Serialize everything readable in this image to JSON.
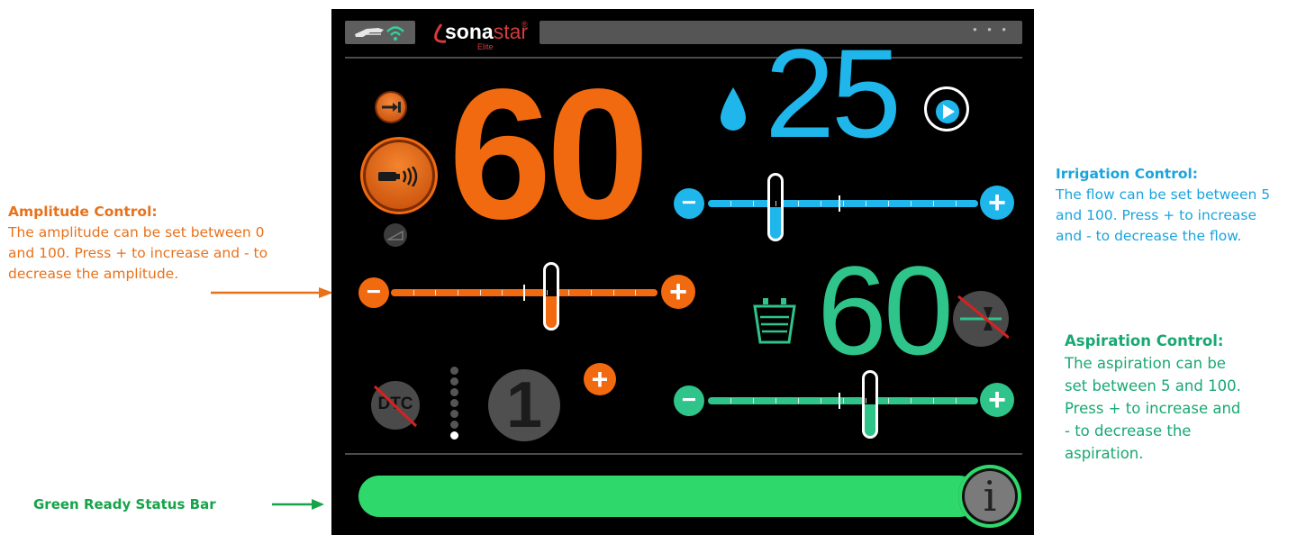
{
  "annotations": {
    "amplitude": {
      "title": "Amplitude Control:",
      "l1": "The amplitude can be set between 0",
      "l2": "and 100. Press + to increase and - to",
      "l3": "decrease the amplitude."
    },
    "irrigation": {
      "title": "Irrigation Control:",
      "l1": "The flow can be set between 5",
      "l2": "and 100. Press + to increase",
      "l3": "and - to decrease the flow."
    },
    "aspiration": {
      "title": "Aspiration Control:",
      "l1": "The aspiration can be",
      "l2": "set between 5 and 100.",
      "l3": "Press + to increase and",
      "l4": "- to decrease the",
      "l5": "aspiration."
    },
    "status": {
      "label": "Green Ready Status Bar"
    }
  },
  "header": {
    "brand_bold": "sona",
    "brand_light": "star",
    "brand_sub": "Elite",
    "reg": "®",
    "menu_dots": "• • •"
  },
  "amplitude": {
    "value": "60",
    "level": 0.6
  },
  "irrigation": {
    "value": "25",
    "level": 0.25
  },
  "aspiration": {
    "value": "60",
    "level": 0.6
  },
  "dtc": {
    "label": "DTC",
    "step": "1",
    "plus": "+"
  },
  "slider_buttons": {
    "minus": "−",
    "plus": "+"
  },
  "status_bar": {
    "info_glyph": "i",
    "state": "ready"
  },
  "colors": {
    "amplitude": "#f26a10",
    "irrigation": "#1fb6ec",
    "aspiration": "#2ec48a",
    "status": "#2fd86a",
    "annotation_orange": "#e8721c",
    "annotation_green": "#16a34a"
  }
}
